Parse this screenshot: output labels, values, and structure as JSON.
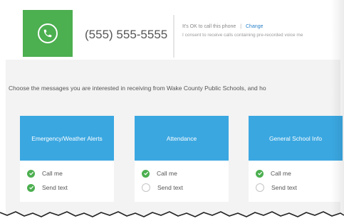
{
  "phone": {
    "number": "(555) 555-5555",
    "ok_text": "It's OK to call this phone",
    "separator": "|",
    "change_label": "Change",
    "consent_text": "I consent to receive calls containing pre-recorded voice me"
  },
  "intro_text": "Choose the messages you are interested in receiving from Wake County Public Schools, and ho",
  "cards": [
    {
      "title": "Emergency/Weather Alerts",
      "options": [
        {
          "label": "Call me",
          "checked": true
        },
        {
          "label": "Send text",
          "checked": true
        }
      ]
    },
    {
      "title": "Attendance",
      "options": [
        {
          "label": "Call me",
          "checked": true
        },
        {
          "label": "Send text",
          "checked": false
        }
      ]
    },
    {
      "title": "General School Info",
      "options": [
        {
          "label": "Call me",
          "checked": true
        },
        {
          "label": "Send text",
          "checked": false
        }
      ]
    }
  ],
  "colors": {
    "accent_green": "#4caf50",
    "card_blue": "#3aa7e1",
    "link_blue": "#2b82c9"
  },
  "icons": {
    "phone": "phone-icon",
    "check": "check-icon"
  }
}
